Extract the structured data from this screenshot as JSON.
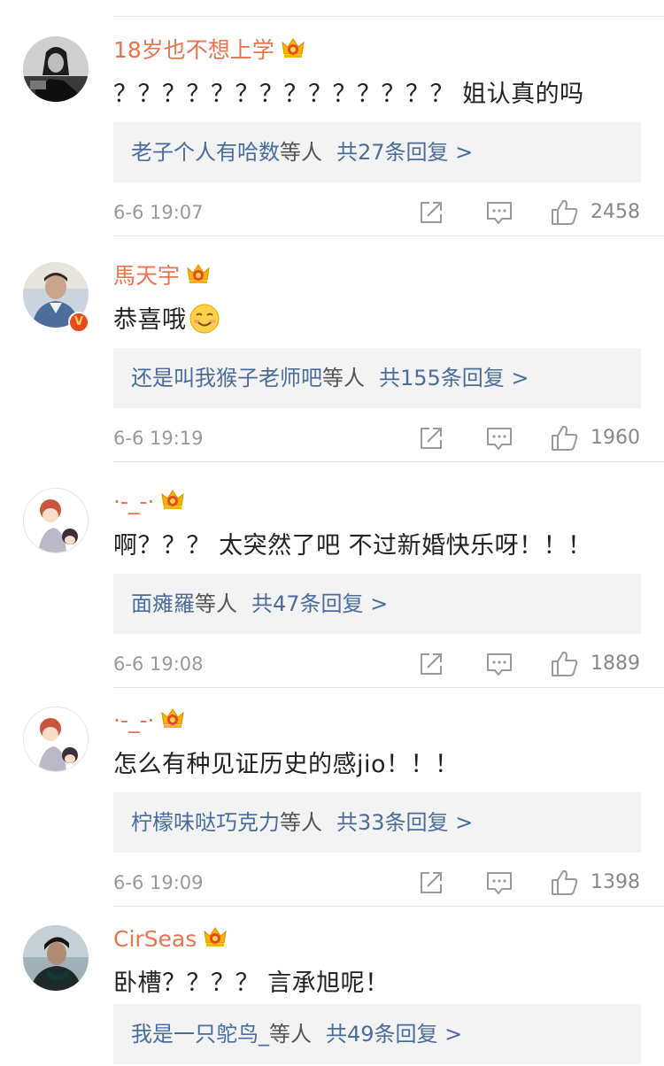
{
  "comments": [
    {
      "username": "18岁也不想上学",
      "text": "？？？？？？？？？？？？？？ 姐认真的吗",
      "reply_names": "老子个人有哈数",
      "reply_suffix": "等人",
      "reply_count": "共27条回复 >",
      "time": "6-6 19:07",
      "likes": "2458",
      "avatar_icon": "avatar-woman-bw"
    },
    {
      "username": "馬天宇",
      "text": "恭喜哦",
      "emoji": "smile-emoji",
      "verified": "V",
      "reply_names": "还是叫我猴子老师吧",
      "reply_suffix": "等人",
      "reply_count": "共155条回复 >",
      "time": "6-6 19:19",
      "likes": "1960",
      "avatar_icon": "avatar-man-denim"
    },
    {
      "username": "·-_-·",
      "text": "啊？？？ 太突然了吧 不过新婚快乐呀！！！",
      "reply_names": "面瘫羅",
      "reply_suffix": "等人",
      "reply_count": "共47条回复 >",
      "time": "6-6 19:08",
      "likes": "1889",
      "avatar_icon": "avatar-anime"
    },
    {
      "username": "·-_-·",
      "text": "怎么有种见证历史的感jio！！！",
      "reply_names": "柠檬味哒巧克力",
      "reply_suffix": "等人",
      "reply_count": "共33条回复 >",
      "time": "6-6 19:09",
      "likes": "1398",
      "avatar_icon": "avatar-anime"
    },
    {
      "username": "CirSeas",
      "text": "卧槽？？？？ 言承旭呢！",
      "reply_names": "我是一只鸵鸟_",
      "reply_suffix": "等人",
      "reply_count": "共49条回复 >",
      "avatar_icon": "avatar-man-dark"
    }
  ],
  "colors": {
    "username": "#eb7350",
    "link": "#4a6b9e",
    "reply_bg": "#f3f3f3",
    "meta": "#999999"
  }
}
